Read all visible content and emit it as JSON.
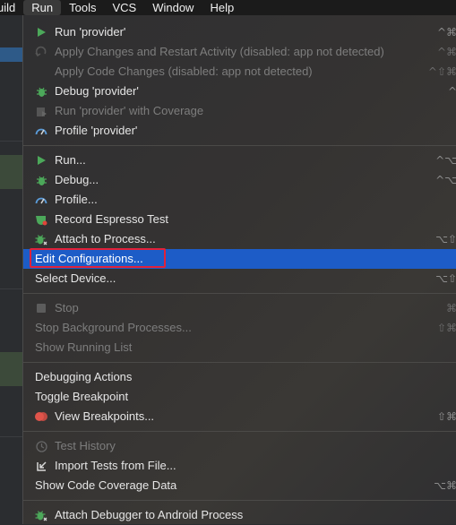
{
  "menubar": {
    "items": [
      {
        "label": "uild"
      },
      {
        "label": "Run"
      },
      {
        "label": "Tools"
      },
      {
        "label": "VCS"
      },
      {
        "label": "Window"
      },
      {
        "label": "Help"
      }
    ],
    "active_index": 1
  },
  "run_menu": {
    "items": [
      {
        "label": "Run 'provider'",
        "shortcut": "^⌘",
        "icon": "play-icon",
        "disabled": false
      },
      {
        "label": "Apply Changes and Restart Activity (disabled: app not detected)",
        "shortcut": "^⌘",
        "icon": "apply-changes-icon",
        "disabled": true
      },
      {
        "label": "Apply Code Changes (disabled: app not detected)",
        "shortcut": "^⇧⌘",
        "icon": "apply-code-changes-icon",
        "disabled": true
      },
      {
        "label": "Debug 'provider'",
        "shortcut": "^",
        "icon": "debug-bug-icon",
        "disabled": false
      },
      {
        "label": "Run 'provider' with Coverage",
        "shortcut": "",
        "icon": "coverage-icon",
        "disabled": true
      },
      {
        "label": "Profile 'provider'",
        "shortcut": "",
        "icon": "profile-gauge-icon",
        "disabled": false
      },
      {
        "label": "Run...",
        "shortcut": "^⌥",
        "icon": "play-icon",
        "disabled": false
      },
      {
        "label": "Debug...",
        "shortcut": "^⌥",
        "icon": "debug-bug-icon",
        "disabled": false
      },
      {
        "label": "Profile...",
        "shortcut": "",
        "icon": "profile-gauge-icon",
        "disabled": false
      },
      {
        "label": "Record Espresso Test",
        "shortcut": "",
        "icon": "record-espresso-icon",
        "disabled": false
      },
      {
        "label": "Attach to Process...",
        "shortcut": "⌥⇧",
        "icon": "attach-bug-icon",
        "disabled": false
      },
      {
        "label": "Edit Configurations...",
        "shortcut": "",
        "icon": "",
        "disabled": false,
        "selected": true
      },
      {
        "label": "Select Device...",
        "shortcut": "⌥⇧",
        "icon": "",
        "disabled": false
      },
      {
        "label": "Stop",
        "shortcut": "⌘",
        "icon": "stop-icon",
        "disabled": true
      },
      {
        "label": "Stop Background Processes...",
        "shortcut": "⇧⌘",
        "icon": "",
        "disabled": true
      },
      {
        "label": "Show Running List",
        "shortcut": "",
        "icon": "",
        "disabled": true
      },
      {
        "label": "Debugging Actions",
        "shortcut": "",
        "icon": "",
        "disabled": false
      },
      {
        "label": "Toggle Breakpoint",
        "shortcut": "",
        "icon": "",
        "disabled": false
      },
      {
        "label": "View Breakpoints...",
        "shortcut": "⇧⌘",
        "icon": "breakpoints-icon",
        "disabled": false
      },
      {
        "label": "Test History",
        "shortcut": "",
        "icon": "clock-history-icon",
        "disabled": true
      },
      {
        "label": "Import Tests from File...",
        "shortcut": "",
        "icon": "import-tests-icon",
        "disabled": false
      },
      {
        "label": "Show Code Coverage Data",
        "shortcut": "⌥⌘",
        "icon": "",
        "disabled": false
      },
      {
        "label": "Attach Debugger to Android Process",
        "shortcut": "",
        "icon": "attach-bug-icon",
        "disabled": false
      }
    ]
  },
  "colors": {
    "selection": "#1d5cc7",
    "focus_outline": "#e2213a",
    "run_green": "#4ca85a",
    "profile_blue": "#5a9bd8"
  }
}
